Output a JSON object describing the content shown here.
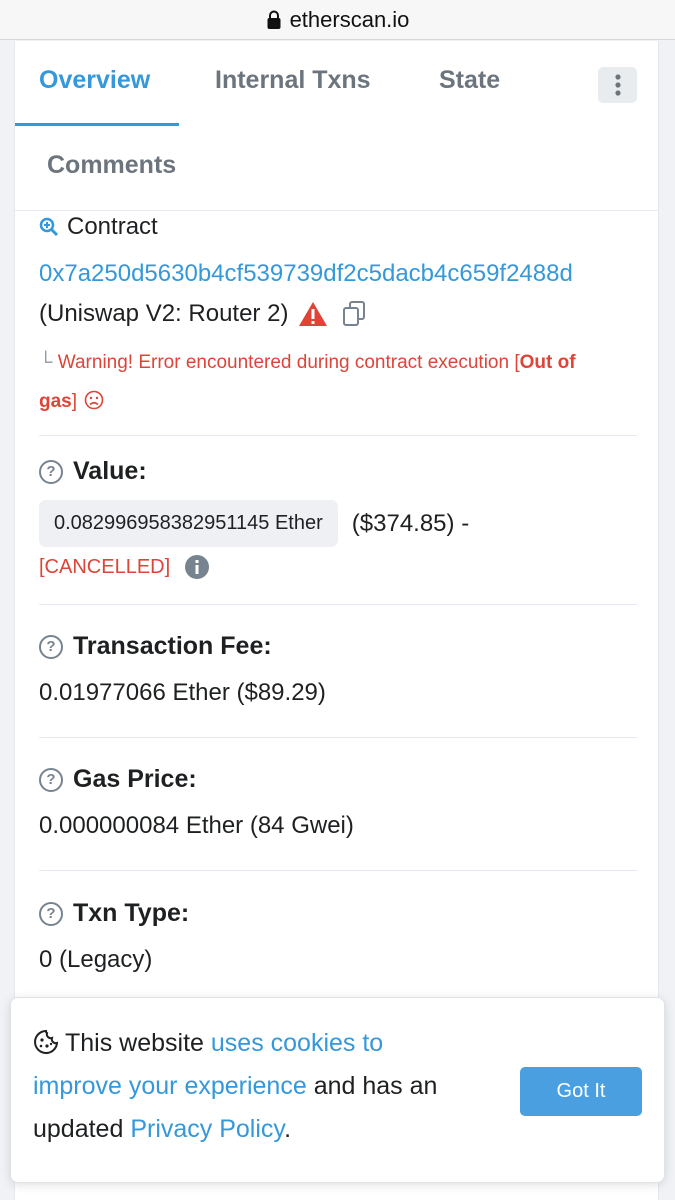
{
  "browser": {
    "url": "etherscan.io"
  },
  "tabs": [
    {
      "label": "Overview",
      "active": true
    },
    {
      "label": "Internal Txns",
      "active": false
    },
    {
      "label": "State",
      "active": false
    },
    {
      "label": "Comments",
      "active": false
    }
  ],
  "to": {
    "prefix": "Contract",
    "address": "0x7a250d5630b4cf539739df2c5dacb4c659f2488d",
    "name": "(Uniswap V2: Router 2)",
    "warning_prefix": "Warning! Error encountered during contract execution [",
    "warning_reason": "Out of",
    "warning_reason_cont": "gas",
    "warning_suffix": "]"
  },
  "value": {
    "label": "Value:",
    "amount": "0.082996958382951145 Ether",
    "usd": "($374.85) -",
    "status": "[CANCELLED]"
  },
  "fee": {
    "label": "Transaction Fee:",
    "amount": "0.01977066 Ether ($89.29)"
  },
  "gas_price": {
    "label": "Gas Price:",
    "amount": "0.000000084 Ether (84 Gwei)"
  },
  "txn_type": {
    "label": "Txn Type:",
    "value": "0 (Legacy)"
  },
  "cookie": {
    "text_1": "This website ",
    "link_1": "uses cookies to",
    "link_1b": "improve your experience",
    "text_2": " and has an",
    "text_3": "updated ",
    "link_2": "Privacy Policy",
    "text_4": ".",
    "button": "Got It"
  },
  "colors": {
    "accent": "#3498db",
    "danger": "#de4437",
    "button": "#4a9fe0"
  },
  "icons": [
    "lock-icon",
    "more-vertical-icon",
    "zoom-icon",
    "warning-triangle-icon",
    "copy-icon",
    "corner-arrow-icon",
    "sad-face-icon",
    "help-icon",
    "info-icon",
    "cookie-icon"
  ]
}
